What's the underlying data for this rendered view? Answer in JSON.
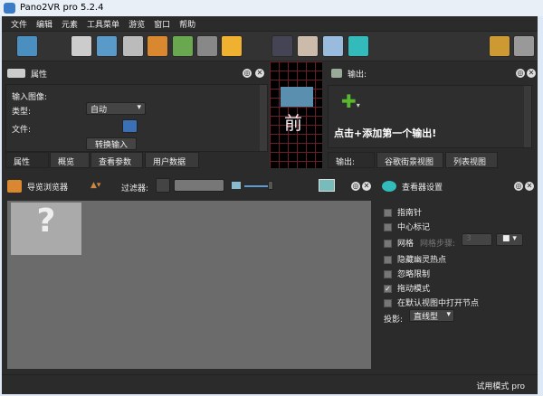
{
  "window": {
    "title": "Pano2VR pro 5.2.4"
  },
  "menu": [
    "文件",
    "编辑",
    "元素",
    "工具菜单",
    "游览",
    "窗口",
    "帮助"
  ],
  "properties": {
    "title": "属性",
    "input_image_label": "输入图像:",
    "type_label": "类型:",
    "type_value": "自动",
    "file_label": "文件:",
    "convert_button": "转换输入"
  },
  "props_tabs": [
    "属性",
    "概览",
    "查看参数",
    "用户数据"
  ],
  "preview": {
    "face_label": "前"
  },
  "output": {
    "title": "输出:",
    "hint": "点击+添加第一个输出!",
    "tabs": [
      "输出:",
      "谷歌街景视图",
      "列表视图"
    ]
  },
  "browser": {
    "title": "导览浏览器",
    "filter_label": "过滤器:",
    "filter_value": ""
  },
  "viewer_settings": {
    "title": "查看器设置",
    "options": [
      {
        "label": "指南针",
        "checked": false
      },
      {
        "label": "中心标记",
        "checked": false
      },
      {
        "label": "网格",
        "checked": false
      },
      {
        "label": "隐藏幽灵热点",
        "checked": false
      },
      {
        "label": "忽略限制",
        "checked": false
      },
      {
        "label": "拖动模式",
        "checked": true
      },
      {
        "label": "在默认视图中打开节点",
        "checked": false
      }
    ],
    "grid_step_label": "网格步骤:",
    "grid_step_value": "3",
    "projection_label": "投影:",
    "projection_value": "直线型"
  },
  "status": {
    "text": "试用模式 pro"
  },
  "colors": {
    "accent": "#5ab82e",
    "browser_bg": "#6b6b6b",
    "panel_bg": "#2b2b2b"
  }
}
